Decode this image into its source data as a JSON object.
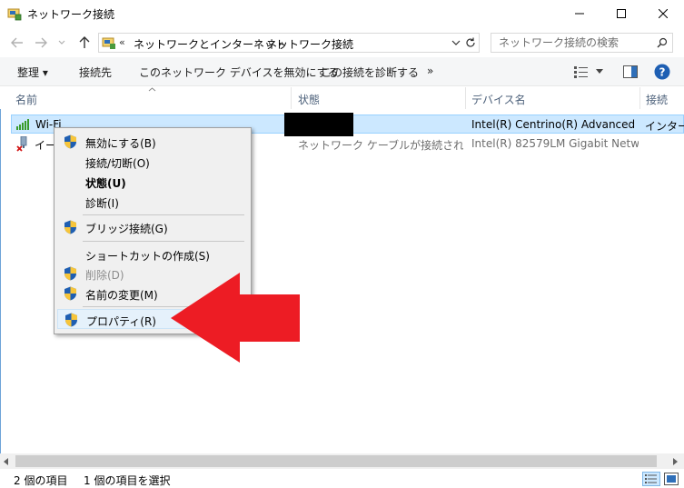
{
  "window": {
    "title": "ネットワーク接続"
  },
  "address": {
    "prefix": "«",
    "crumbs": [
      "ネットワークとインターネット",
      "ネットワーク接続"
    ]
  },
  "search": {
    "placeholder": "ネットワーク接続の検索"
  },
  "toolbar": {
    "organize": "整理 ▾",
    "connect_to": "接続先",
    "disable_device": "このネットワーク デバイスを無効にする",
    "diagnose": "この接続を診断する",
    "more": "»"
  },
  "columns": {
    "name": "名前",
    "status": "状態",
    "device": "デバイス名",
    "connectivity": "接続"
  },
  "rows": [
    {
      "name": "Wi-Fi",
      "status": "",
      "device": "Intel(R) Centrino(R) Advanced-...",
      "connectivity": "インターネ"
    },
    {
      "name": "イーサネット",
      "status": "ネットワーク ケーブルが接続されてい...",
      "device": "Intel(R) 82579LM Gigabit Netwo...",
      "connectivity": ""
    }
  ],
  "context_menu": {
    "items": [
      {
        "label": "無効にする(B)"
      },
      {
        "label": "接続/切断(O)"
      },
      {
        "label": "状態(U)"
      },
      {
        "label": "診断(I)"
      },
      {
        "label": "ブリッジ接続(G)"
      },
      {
        "label": "ショートカットの作成(S)"
      },
      {
        "label": "削除(D)"
      },
      {
        "label": "名前の変更(M)"
      },
      {
        "label": "プロパティ(R)"
      }
    ]
  },
  "statusbar": {
    "count": "2 個の項目",
    "selected": "1 個の項目を選択"
  },
  "colors": {
    "selection": "#cce8ff",
    "arrow": "#ed1c24",
    "accent": "#0078d7"
  }
}
